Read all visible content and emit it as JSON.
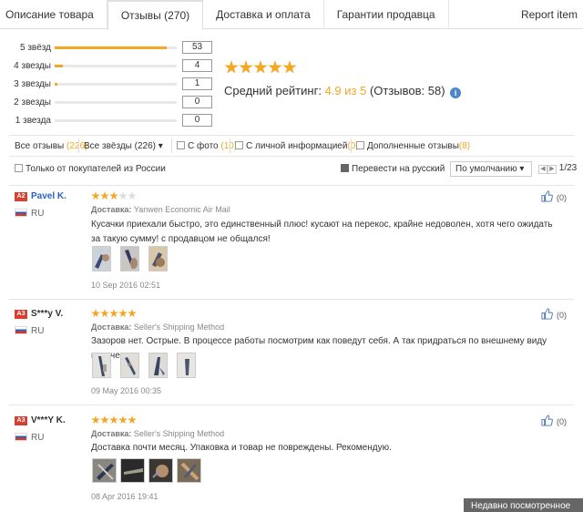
{
  "tabs": [
    {
      "label": "Описание товара"
    },
    {
      "label": "Отзывы (270)"
    },
    {
      "label": "Доставка и оплата"
    },
    {
      "label": "Гарантии продавца"
    }
  ],
  "report_label": "Report item",
  "rating_bars": [
    {
      "label": "5 звёзд",
      "count": "53",
      "fraction": 0.92
    },
    {
      "label": "4 звезды",
      "count": "4",
      "fraction": 0.07
    },
    {
      "label": "3 звезды",
      "count": "1",
      "fraction": 0.02
    },
    {
      "label": "2 звезды",
      "count": "0",
      "fraction": 0
    },
    {
      "label": "1 звезда",
      "count": "0",
      "fraction": 0
    }
  ],
  "average": {
    "stars": 5,
    "label": "Средний рейтинг:",
    "value": "4.9 из 5",
    "reviews_text": "(Отзывов: 58)",
    "info_icon": "i"
  },
  "filters": {
    "all_reviews": "Все отзывы",
    "all_reviews_count": "(226)",
    "all_stars": "Все звёзды (226)",
    "with_photo": "С фото",
    "with_photo_count": "(10)",
    "personal_info": "С личной информацией",
    "personal_info_count": "(0)",
    "additional": "Дополненные отзывы",
    "additional_count": "(8)",
    "russia_only": "Только от покупателей из России",
    "translate": "Перевести на русский",
    "sort": "По умолчанию",
    "page": "1/23"
  },
  "reviews": [
    {
      "level": "A2",
      "name": "Pavel K.",
      "country": "RU",
      "stars": 3,
      "delivery_label": "Доставка:",
      "delivery": "Yanwen Economic Air Mail",
      "text": "Кусачки приехали быстро, это единственный плюс! кусают на перекос, крайне недоволен, хотя чего ожидать за такую сумму! с продавцом не общался!",
      "date": "10 Sep 2016 02:51",
      "likes": "(0)"
    },
    {
      "level": "A3",
      "name": "S***y V.",
      "country": "RU",
      "stars": 5,
      "delivery_label": "Доставка:",
      "delivery": "Seller's Shipping Method",
      "text": "Зазоров нет. Острые. В процессе работы посмотрим как поведут себя. А так придраться по внешнему виду не к чему.",
      "date": "09 May 2016 00:35",
      "likes": "(0)"
    },
    {
      "level": "A3",
      "name": "V***Y K.",
      "country": "RU",
      "stars": 5,
      "delivery_label": "Доставка:",
      "delivery": "Seller's Shipping Method",
      "text": "Доставка почти месяц. Упаковка и товар не повреждены. Рекомендую.",
      "date": "08 Apr 2016 19:41",
      "likes": "(0)"
    }
  ],
  "recently_viewed": "Недавно посмотренное",
  "colors": {
    "accent": "#f5a623",
    "link": "#2a62b8",
    "level_badge": "#d64030"
  },
  "icons": [
    "star-icon",
    "info-icon",
    "checkbox-icon",
    "thumbs-up-icon",
    "flag-ru-icon",
    "dropdown-arrow-icon",
    "prev-page-icon",
    "next-page-icon"
  ]
}
